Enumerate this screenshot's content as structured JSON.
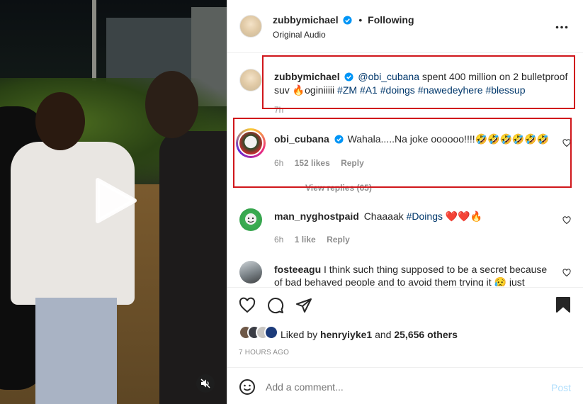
{
  "video": {
    "play_icon": "play-icon",
    "mute_icon": "speaker-muted-icon"
  },
  "header": {
    "username": "zubbymichael",
    "separator": "•",
    "follow_status": "Following",
    "audio": "Original Audio",
    "more_icon": "more-horizontal-icon"
  },
  "caption": {
    "username": "zubbymichael",
    "mention": "@obi_cubana",
    "text_line1_rest": " spent 400 million on 2 bulletproof",
    "text_line2_lead": "suv ",
    "emoji": "🔥",
    "text_line2_word": "oginiiiii ",
    "hashtags": [
      "#ZM",
      "#A1",
      "#doings",
      "#nawedeyhere",
      "#blessup"
    ],
    "time": "7h"
  },
  "comments": [
    {
      "username": "obi_cubana",
      "verified": true,
      "text": "Wahala.....Na joke oooooo!!!!🤣🤣🤣🤣🤣🤣",
      "time": "6h",
      "likes": "152 likes",
      "reply": "Reply",
      "view_replies": "View replies (65)"
    },
    {
      "username": "man_nyghostpaid",
      "text_lead": "Chaaaak ",
      "hashtag": "#Doings",
      "emojis": " ❤️❤️🔥",
      "time": "6h",
      "likes": "1 like",
      "reply": "Reply"
    },
    {
      "username": "fosteeagu",
      "text_line1": "I think such thing supposed to be a secret because",
      "text_line2": "of bad behaved people and to avoid them trying it 😥 just"
    }
  ],
  "likes": {
    "liked_by_prefix": "Liked by ",
    "liked_by_user": "henryiyke1",
    "liked_by_mid": " and ",
    "liked_by_count": "25,656 others"
  },
  "timestamp": "7 HOURS AGO",
  "add_comment": {
    "placeholder": "Add a comment...",
    "post": "Post",
    "emoji_icon": "emoji-smile-icon"
  },
  "colors": {
    "highlight_box": "#d0161b",
    "link": "#00376b",
    "verified": "#0095f6",
    "post_button": "#b2dffc"
  }
}
